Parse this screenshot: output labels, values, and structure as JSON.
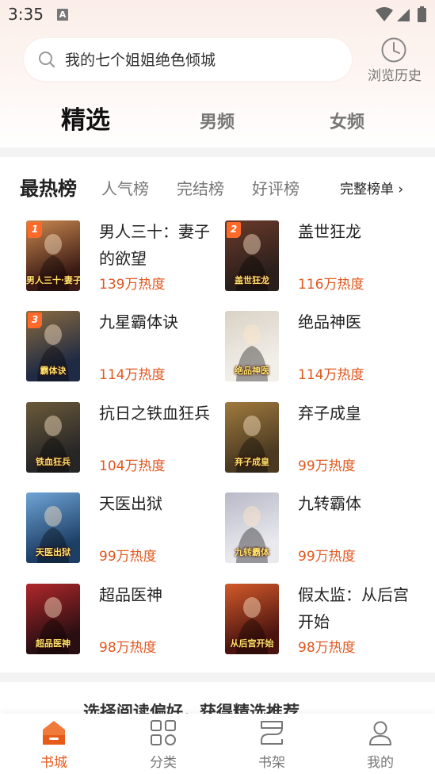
{
  "status_bar": {
    "time": "3:35",
    "notification_badge": "A"
  },
  "search": {
    "placeholder": "我的七个姐姐绝色倾城"
  },
  "history": {
    "label": "浏览历史"
  },
  "main_tabs": [
    "精选",
    "男频",
    "女频"
  ],
  "ranking": {
    "title": "最热榜",
    "sub_tabs": [
      "人气榜",
      "完结榜",
      "好评榜"
    ],
    "full_link": "完整榜单 ›",
    "books": [
      {
        "rank": "1",
        "title": "男人三十：妻子的欲望",
        "heat": "139万热度",
        "cover_text": "男人三十·妻子的秘密"
      },
      {
        "rank": "2",
        "title": "盖世狂龙",
        "heat": "116万热度",
        "cover_text": "盖世狂龙"
      },
      {
        "rank": "3",
        "title": "九星霸体诀",
        "heat": "114万热度",
        "cover_text": "霸体诀"
      },
      {
        "rank": "",
        "title": "绝品神医",
        "heat": "114万热度",
        "cover_text": "绝品神医"
      },
      {
        "rank": "",
        "title": "抗日之铁血狂兵",
        "heat": "104万热度",
        "cover_text": "铁血狂兵"
      },
      {
        "rank": "",
        "title": "弃子成皇",
        "heat": "99万热度",
        "cover_text": "弃子成皇"
      },
      {
        "rank": "",
        "title": "天医出狱",
        "heat": "99万热度",
        "cover_text": "天医出狱"
      },
      {
        "rank": "",
        "title": "九转霸体",
        "heat": "99万热度",
        "cover_text": "九转霸体"
      },
      {
        "rank": "",
        "title": "超品医神",
        "heat": "98万热度",
        "cover_text": "超品医神"
      },
      {
        "rank": "",
        "title": "假太监：从后宫开始",
        "heat": "98万热度",
        "cover_text": "从后宫开始"
      }
    ]
  },
  "teaser_text": "选择阅读偏好，获得精选推荐",
  "bottom_nav": [
    {
      "label": "书城",
      "icon": "bookstore-icon",
      "active": true
    },
    {
      "label": "分类",
      "icon": "category-grid-icon",
      "active": false
    },
    {
      "label": "书架",
      "icon": "bookshelf-icon",
      "active": false
    },
    {
      "label": "我的",
      "icon": "profile-icon",
      "active": false
    }
  ],
  "colors": {
    "accent": "#ea5a1e",
    "heat": "#e0571f",
    "badge": "#ff6a2a",
    "header_bg": "#fbeee9"
  }
}
